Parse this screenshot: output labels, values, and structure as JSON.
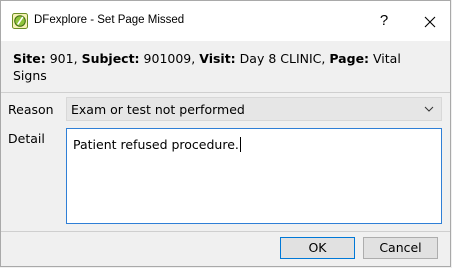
{
  "window": {
    "title": "DFexplore - Set Page Missed",
    "help_glyph": "?",
    "accent_color": "#0078d7"
  },
  "info": {
    "site_label": "Site:",
    "site_value": "901,",
    "subject_label": "Subject:",
    "subject_value": "901009,",
    "visit_label": "Visit:",
    "visit_value": "Day 8 CLINIC,",
    "page_label": "Page:",
    "page_value": "Vital Signs"
  },
  "form": {
    "reason_label": "Reason",
    "reason_selected": "Exam or test not performed",
    "detail_label": "Detail",
    "detail_value": "Patient refused procedure."
  },
  "buttons": {
    "ok_label": "OK",
    "cancel_label": "Cancel"
  },
  "icons": {
    "app": "dfexplore-app-icon",
    "close": "close-icon",
    "dropdown": "chevron-down-icon"
  }
}
